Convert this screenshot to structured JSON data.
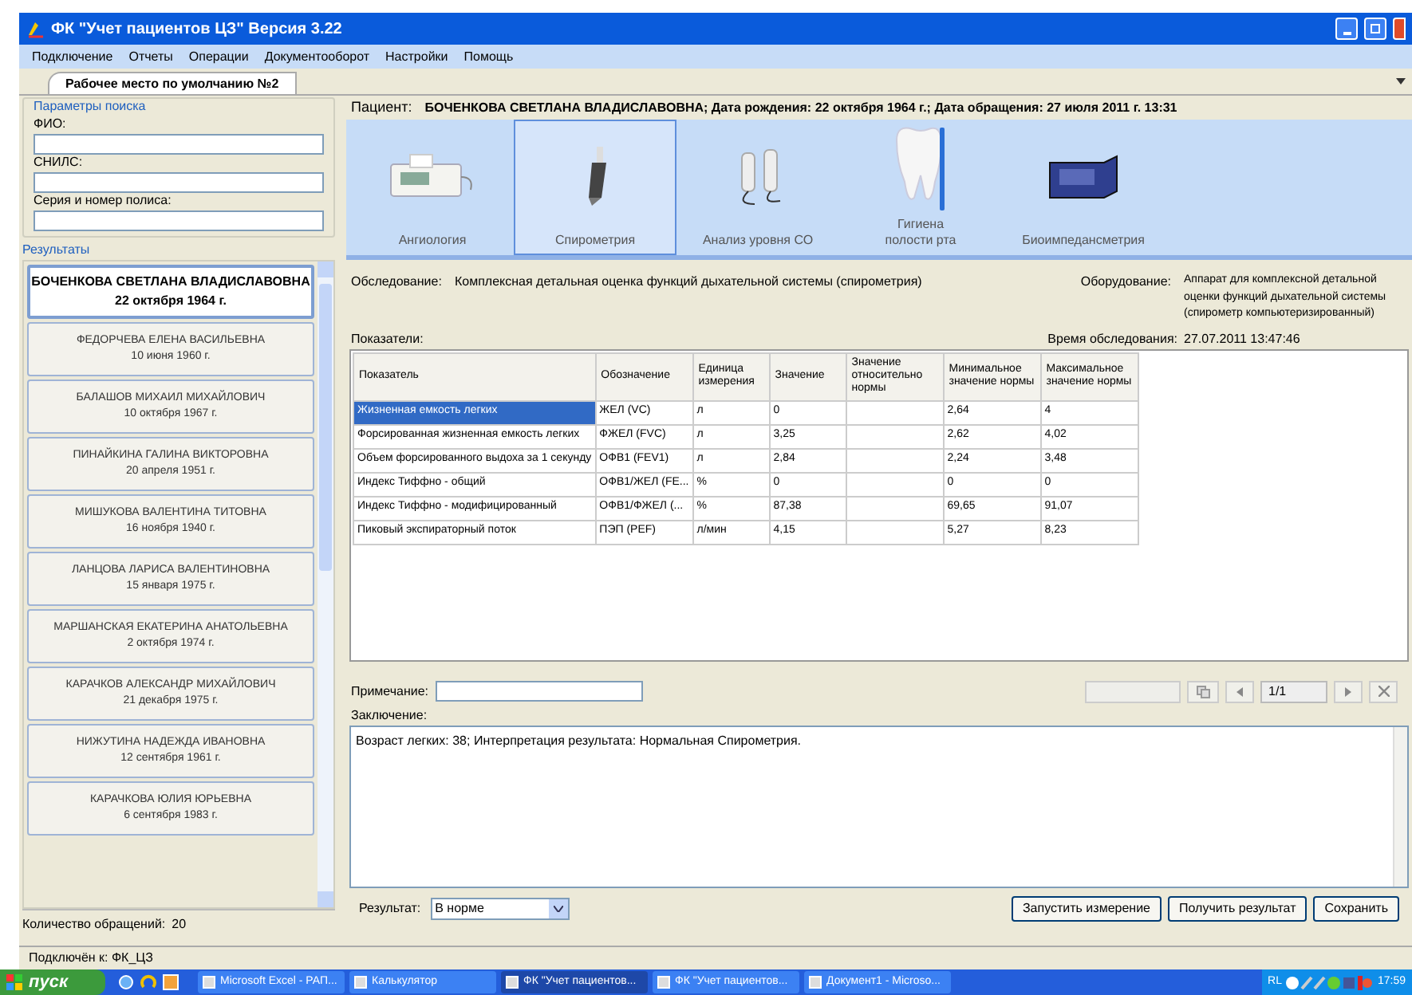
{
  "window": {
    "title": "ФК \"Учет пациентов ЦЗ\" Версия 3.22"
  },
  "menu": [
    "Подключение",
    "Отчеты",
    "Операции",
    "Документооборот",
    "Настройки",
    "Помощь"
  ],
  "doc_tabs": [
    {
      "label": "Рабочее место по умолчанию №2",
      "selected": true
    }
  ],
  "search": {
    "title": "Параметры поиска",
    "fields": [
      {
        "label": "ФИО:"
      },
      {
        "label": "СНИЛС:"
      },
      {
        "label": "Серия и номер полиса:"
      }
    ]
  },
  "results": {
    "title": "Результаты",
    "items": [
      {
        "name": "БОЧЕНКОВА СВЕТЛАНА ВЛАДИСЛАВОВНА",
        "date": "22 октября 1964 г.",
        "selected": true
      },
      {
        "name": "ФЕДОРЧЕВА ЕЛЕНА ВАСИЛЬЕВНА",
        "date": "10 июня 1960 г.",
        "selected": false
      },
      {
        "name": "БАЛАШОВ МИХАИЛ МИХАЙЛОВИЧ",
        "date": "10 октября 1967 г.",
        "selected": false
      },
      {
        "name": "ПИНАЙКИНА ГАЛИНА ВИКТОРОВНА",
        "date": "20 апреля 1951 г.",
        "selected": false
      },
      {
        "name": "МИШУКОВА ВАЛЕНТИНА ТИТОВНА",
        "date": "16 ноября 1940 г.",
        "selected": false
      },
      {
        "name": "ЛАНЦОВА ЛАРИСА ВАЛЕНТИНОВНА",
        "date": "15 января 1975 г.",
        "selected": false
      },
      {
        "name": "МАРШАНСКАЯ ЕКАТЕРИНА АНАТОЛЬЕВНА",
        "date": "2 октября 1974 г.",
        "selected": false
      },
      {
        "name": "КАРАЧКОВ АЛЕКСАНДР МИХАЙЛОВИЧ",
        "date": "21 декабря 1975 г.",
        "selected": false
      },
      {
        "name": "НИЖУТИНА НАДЕЖДА ИВАНОВНА",
        "date": "12 сентября 1961 г.",
        "selected": false
      },
      {
        "name": "КАРАЧКОВА ЮЛИЯ ЮРЬЕВНА",
        "date": "6 сентября 1983 г.",
        "selected": false
      }
    ],
    "count_label": "Количество обращений:",
    "count": "20"
  },
  "patient": {
    "label": "Пациент:",
    "value": "БОЧЕНКОВА СВЕТЛАНА ВЛАДИСЛАВОВНА; Дата рождения: 22 октября 1964 г.; Дата обращения: 27 июля 2011 г. 13:31"
  },
  "devices": [
    {
      "kind": "ecg",
      "label": "Ангиология",
      "selected": false
    },
    {
      "kind": "spiro",
      "label": "Спирометрия",
      "selected": true
    },
    {
      "kind": "co",
      "label": "Анализ уровня СО",
      "selected": false
    },
    {
      "kind": "tooth",
      "label": "Гигиена\nполости рта",
      "selected": false
    },
    {
      "kind": "box",
      "label": "Биоимпедансметрия",
      "selected": false
    }
  ],
  "exam": {
    "label": "Обследование:",
    "value": "Комплексная детальная оценка функций дыхательной системы (спирометрия)",
    "equipment_label": "Оборудование:",
    "equipment": "Аппарат для комплексной детальной оценки функций дыхательной системы (спирометр компьютеризированный)",
    "time_label": "Время обследования:",
    "time": "27.07.2011 13:47:46"
  },
  "table": {
    "title": "Показатели:",
    "columns": [
      "Показатель",
      "Обозначение",
      "Единица измерения",
      "Значение",
      "Значение относительно нормы",
      "Минимальное значение нормы",
      "Максимальное значение нормы"
    ],
    "rows": [
      {
        "cells": [
          "Жизненная емкость легких",
          "ЖЕЛ (VC)",
          "л",
          "0",
          "",
          "2,64",
          "4"
        ],
        "selected": true
      },
      {
        "cells": [
          "Форсированная жизненная емкость легких",
          "ФЖЕЛ (FVC)",
          "л",
          "3,25",
          "",
          "2,62",
          "4,02"
        ],
        "selected": false
      },
      {
        "cells": [
          "Объем форсированного выдоха за 1 секунду",
          "ОФВ1 (FEV1)",
          "л",
          "2,84",
          "",
          "2,24",
          "3,48"
        ],
        "selected": false
      },
      {
        "cells": [
          "Индекс Тиффно - общий",
          "ОФВ1/ЖЕЛ (FE...",
          "%",
          "0",
          "",
          "0",
          "0"
        ],
        "selected": false
      },
      {
        "cells": [
          "Индекс Тиффно - модифицированный",
          "ОФВ1/ФЖЕЛ (...",
          "%",
          "87,38",
          "",
          "69,65",
          "91,07"
        ],
        "selected": false
      },
      {
        "cells": [
          "Пиковый экспираторный поток",
          "ПЭП (PEF)",
          "л/мин",
          "4,15",
          "",
          "5,27",
          "8,23"
        ],
        "selected": false
      }
    ]
  },
  "note": {
    "label": "Примечание:",
    "pager": "1/1"
  },
  "conclusion": {
    "label": "Заключение:",
    "value": "Возраст легких: 38;  Интерпретация результата: Нормальная Спирометрия."
  },
  "result": {
    "label": "Результат:",
    "value": "В норме"
  },
  "buttons": [
    "Запустить измерение",
    "Получить результат",
    "Сохранить"
  ],
  "status_bar": "Подключён к: ФК_ЦЗ",
  "taskbar": {
    "start": "пуск",
    "items": [
      {
        "label": "Microsoft Excel - РАП...",
        "selected": false
      },
      {
        "label": "Калькулятор",
        "selected": false
      },
      {
        "label": "ФК \"Учет пациентов...",
        "selected": true
      },
      {
        "label": "ФК \"Учет пациентов...",
        "selected": false
      },
      {
        "label": "Документ1 - Microso...",
        "selected": false
      }
    ],
    "lang": "RL",
    "clock": "17:59"
  }
}
